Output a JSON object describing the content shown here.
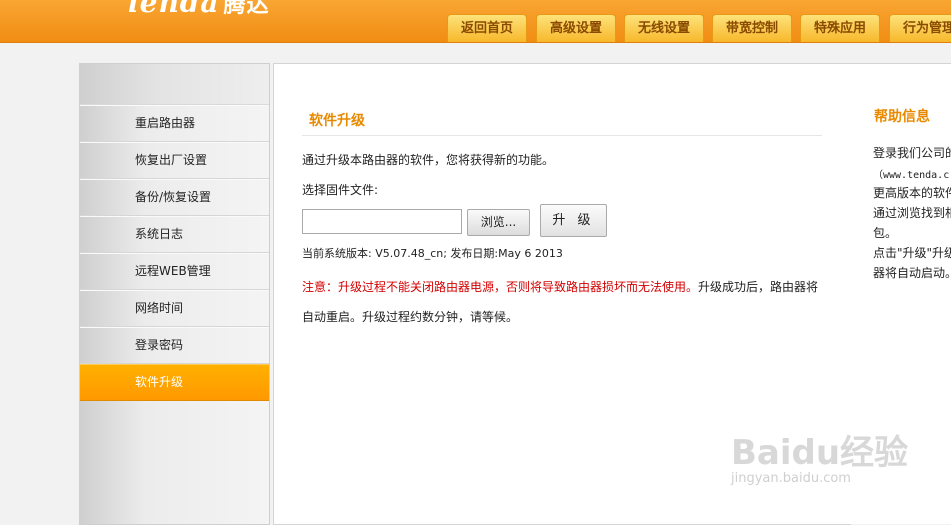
{
  "header": {
    "logo_text": "lenda",
    "logo_cn": "腾达",
    "tabs": [
      {
        "label": "返回首页"
      },
      {
        "label": "高级设置"
      },
      {
        "label": "无线设置"
      },
      {
        "label": "带宽控制"
      },
      {
        "label": "特殊应用"
      },
      {
        "label": "行为管理"
      }
    ]
  },
  "sidebar": {
    "items": [
      {
        "label": "重启路由器"
      },
      {
        "label": "恢复出厂设置"
      },
      {
        "label": "备份/恢复设置"
      },
      {
        "label": "系统日志"
      },
      {
        "label": "远程WEB管理"
      },
      {
        "label": "网络时间"
      },
      {
        "label": "登录密码"
      },
      {
        "label": "软件升级"
      }
    ],
    "active_index": 7
  },
  "main": {
    "title": "软件升级",
    "description": "通过升级本路由器的软件，您将获得新的功能。",
    "file_label": "选择固件文件:",
    "file_value": "",
    "browse_label": "浏览...",
    "upgrade_label": "升 级",
    "version_text": "当前系统版本: V5.07.48_cn; 发布日期:May 6 2013",
    "notice_red": "注意：升级过程不能关闭路由器电源，否则将导致路由器损坏而无法使用。",
    "notice_rest_1": "升级成功后，路由器将",
    "notice_rest_2": "自动重启。升级过程约数分钟，请等候。"
  },
  "help": {
    "title": "帮助信息",
    "lines": [
      "登录我们公司的",
      "（www.tenda.c",
      "更高版本的软件",
      "通过浏览找到相",
      "包。",
      "点击\"升级\"升级",
      "器将自动启动。"
    ]
  },
  "watermark": {
    "text": "Baidu经验",
    "url": "jingyan.baidu.com"
  },
  "colors": {
    "header_orange": "#f7a02a",
    "accent_orange": "#e88a00",
    "warning_red": "#d40000",
    "active_item": "#ff9900"
  }
}
